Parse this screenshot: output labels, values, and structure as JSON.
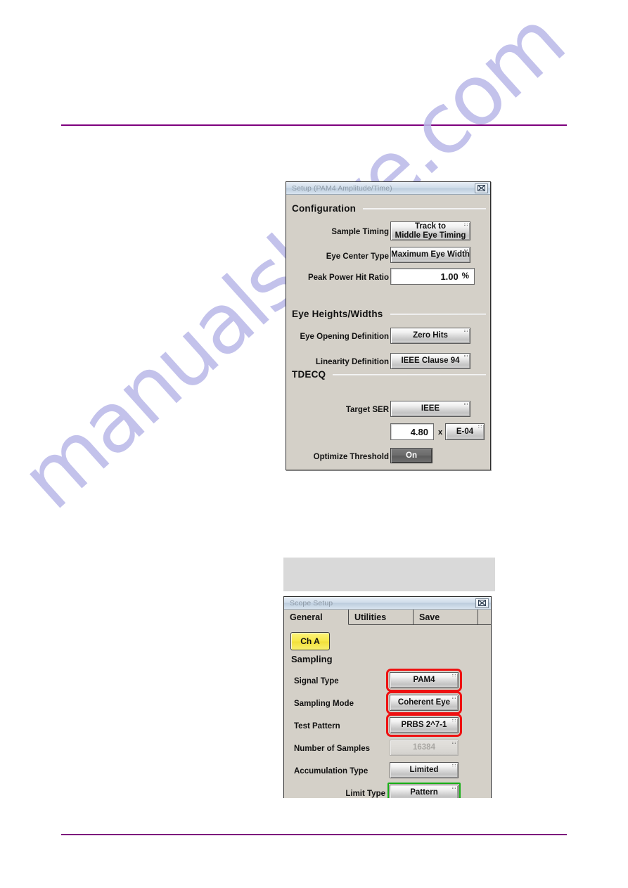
{
  "page": {
    "rule_color": "#7d007d",
    "watermark_text": "manualshive.com"
  },
  "setup_dialog": {
    "title": "Setup (PAM4 Amplitude/Time)",
    "close_label": "Close",
    "sections": [
      {
        "label": "Configuration"
      },
      {
        "label": "Eye Heights/Widths"
      },
      {
        "label": "TDECQ"
      }
    ],
    "rows": [
      {
        "label": "Sample Timing",
        "value": "Track to\nMiddle Eye Timing"
      },
      {
        "label": "Eye Center Type",
        "value": "Maximum Eye Width"
      },
      {
        "label": "Peak Power Hit Ratio",
        "value": "1.00",
        "unit": "%"
      },
      {
        "label": "Eye Opening Definition",
        "value": "Zero Hits"
      },
      {
        "label": "Linearity Definition",
        "value": "IEEE Clause 94"
      },
      {
        "label": "Target SER",
        "value": "IEEE"
      },
      {
        "label": "",
        "value": "4.80",
        "multiplier_symbol": "x",
        "exponent": "E-04"
      },
      {
        "label": "Optimize Threshold",
        "value": "On"
      }
    ]
  },
  "scope_dialog": {
    "title": "Scope Setup",
    "close_label": "Close",
    "tabs": [
      {
        "label": "General",
        "active": true
      },
      {
        "label": "Utilities",
        "active": false
      },
      {
        "label": "Save",
        "active": false
      }
    ],
    "channel_chip": "Ch A",
    "section_label": "Sampling",
    "rows": [
      {
        "label": "Signal Type",
        "value": "PAM4",
        "highlight": "red"
      },
      {
        "label": "Sampling Mode",
        "value": "Coherent Eye",
        "highlight": "red"
      },
      {
        "label": "Test Pattern",
        "value": "PRBS 2^7-1",
        "highlight": "red"
      },
      {
        "label": "Number of Samples",
        "value": "16384",
        "disabled": true
      },
      {
        "label": "Accumulation Type",
        "value": "Limited"
      },
      {
        "label": "Limit Type",
        "value": "Pattern",
        "highlight": "green"
      }
    ]
  },
  "colors": {
    "highlight_red": "#ee1111",
    "highlight_green": "#17b017",
    "chip_yellow": "#f7e94e",
    "dialog_face": "#d4d0c8"
  }
}
